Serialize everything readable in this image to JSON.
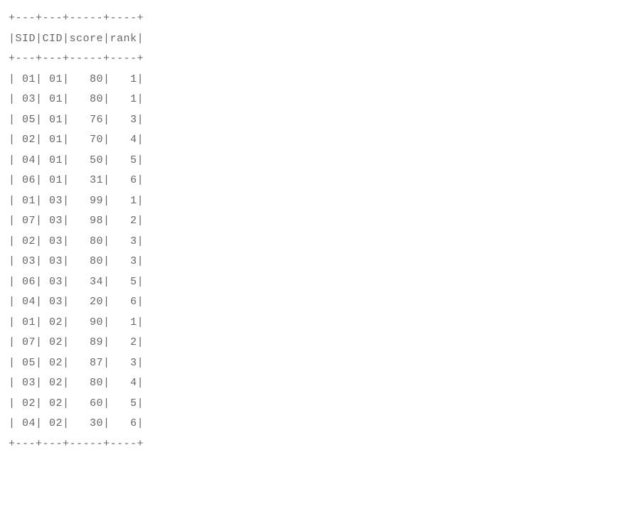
{
  "table": {
    "border": "+---+---+-----+----+",
    "headers": {
      "sid": "SID",
      "cid": "CID",
      "score": "score",
      "rank": "rank"
    },
    "rows": [
      {
        "sid": "01",
        "cid": "01",
        "score": "80",
        "rank": "1"
      },
      {
        "sid": "03",
        "cid": "01",
        "score": "80",
        "rank": "1"
      },
      {
        "sid": "05",
        "cid": "01",
        "score": "76",
        "rank": "3"
      },
      {
        "sid": "02",
        "cid": "01",
        "score": "70",
        "rank": "4"
      },
      {
        "sid": "04",
        "cid": "01",
        "score": "50",
        "rank": "5"
      },
      {
        "sid": "06",
        "cid": "01",
        "score": "31",
        "rank": "6"
      },
      {
        "sid": "01",
        "cid": "03",
        "score": "99",
        "rank": "1"
      },
      {
        "sid": "07",
        "cid": "03",
        "score": "98",
        "rank": "2"
      },
      {
        "sid": "02",
        "cid": "03",
        "score": "80",
        "rank": "3"
      },
      {
        "sid": "03",
        "cid": "03",
        "score": "80",
        "rank": "3"
      },
      {
        "sid": "06",
        "cid": "03",
        "score": "34",
        "rank": "5"
      },
      {
        "sid": "04",
        "cid": "03",
        "score": "20",
        "rank": "6"
      },
      {
        "sid": "01",
        "cid": "02",
        "score": "90",
        "rank": "1"
      },
      {
        "sid": "07",
        "cid": "02",
        "score": "89",
        "rank": "2"
      },
      {
        "sid": "05",
        "cid": "02",
        "score": "87",
        "rank": "3"
      },
      {
        "sid": "03",
        "cid": "02",
        "score": "80",
        "rank": "4"
      },
      {
        "sid": "02",
        "cid": "02",
        "score": "60",
        "rank": "5"
      },
      {
        "sid": "04",
        "cid": "02",
        "score": "30",
        "rank": "6"
      }
    ]
  }
}
